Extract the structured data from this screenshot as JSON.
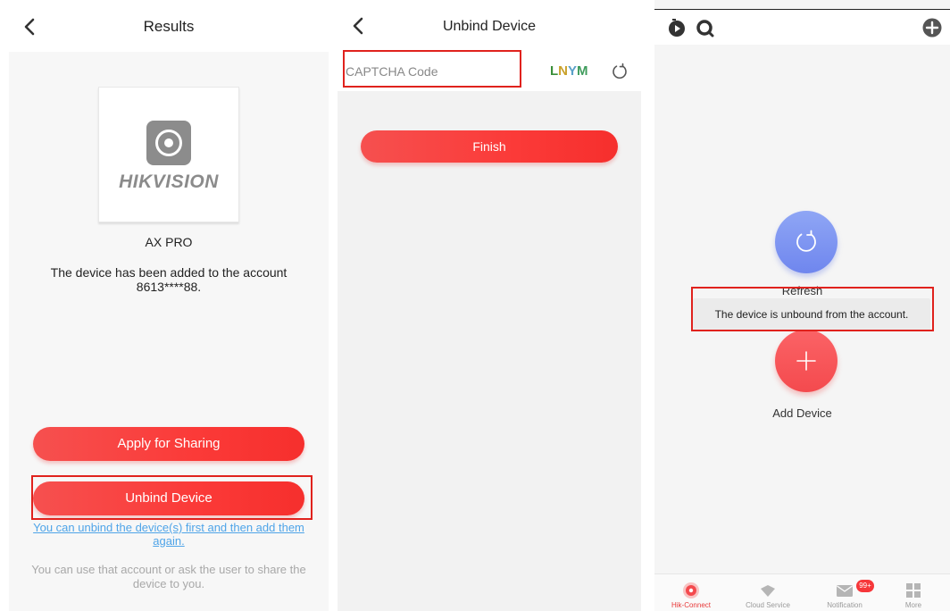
{
  "screen1": {
    "title": "Results",
    "device_brand": "HIKVISION",
    "device_name": "AX PRO",
    "added_msg_line1": "The device has been added to the account",
    "added_msg_line2": "8613****88.",
    "apply_sharing_label": "Apply for Sharing",
    "unbind_label": "Unbind Device",
    "unbind_link_line1": "You can unbind the device(s) first and then add them",
    "unbind_link_line2": "again.",
    "hint_line1": "You can use that account or ask the user to share the",
    "hint_line2": "device to you."
  },
  "screen2": {
    "title": "Unbind Device",
    "captcha_placeholder": "CAPTCHA Code",
    "captcha_chars": [
      {
        "char": "L",
        "color": "#3a8f3a"
      },
      {
        "char": "N",
        "color": "#c9a12a"
      },
      {
        "char": "Y",
        "color": "#5aa0c8"
      },
      {
        "char": "M",
        "color": "#3f9c5c"
      }
    ],
    "finish_label": "Finish"
  },
  "screen3": {
    "refresh_label": "Refresh",
    "toast_text": "The device is unbound from the account.",
    "add_device_label": "Add Device",
    "notification_badge": "99+",
    "tabs": [
      {
        "label": "Hik-Connect",
        "icon": "hik-connect-icon",
        "active": true
      },
      {
        "label": "Cloud Service",
        "icon": "cloud-service-icon",
        "active": false
      },
      {
        "label": "Notification",
        "icon": "envelope-icon",
        "active": false
      },
      {
        "label": "More",
        "icon": "grid-icon",
        "active": false
      }
    ]
  },
  "colors": {
    "accent_red": "#f53b39",
    "highlight_box": "#e0221d",
    "link_blue": "#4fa4e8",
    "refresh_blue": "#7a90f0"
  }
}
